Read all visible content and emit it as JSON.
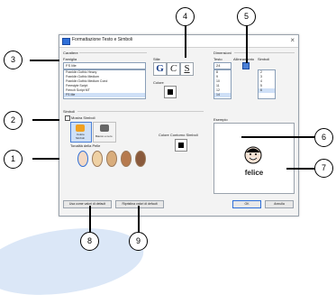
{
  "dialog": {
    "title": "Formattazione Testo e Simboli",
    "close": "×"
  },
  "carattere": {
    "section_label": "Carattere",
    "font_label": "Famiglia",
    "font_value": "FS Me",
    "font_list": [
      "Franklin Gothic Heavy",
      "Franklin Gothic Medium",
      "Franklin Gothic Medium Cond",
      "Freestyle Script",
      "French Script MT",
      "FS Me"
    ]
  },
  "stile": {
    "label": "Stile",
    "bold": "G",
    "italic": "C",
    "underline": "S",
    "color_label": "Colore"
  },
  "dimensioni": {
    "section_label": "Dimensioni",
    "testo_label": "Testo",
    "testo_value": "24",
    "testo_list": [
      "8",
      "9",
      "10",
      "11",
      "12",
      "14"
    ],
    "allineamento_label": "Allineamento",
    "simboli_label": "Simboli",
    "simboli_list": [
      "2",
      "3",
      "4",
      "5",
      "6"
    ]
  },
  "simboli": {
    "section_label": "Simboli",
    "mostra_label": "Mostra Simboli",
    "colore_label": "Colore",
    "colore_sub": "Simboli",
    "bianco_label": "Bianco e nero",
    "tonalita_label": "Tonalità della Pelle",
    "contorno_label": "Colore Contorno Simboli"
  },
  "esempio": {
    "label": "Esempio",
    "word": "felice"
  },
  "buttons": {
    "usa_come": "Usa come valori di default",
    "ripristina": "Ripristina valori di default",
    "ok": "OK",
    "annulla": "Annulla"
  },
  "callouts": [
    "1",
    "2",
    "3",
    "4",
    "5",
    "6",
    "7",
    "8",
    "9"
  ],
  "colors": {
    "accent": "#2f6fd8",
    "skin_tones": [
      "#f3d9c4",
      "#efd1a4",
      "#d9ad7c",
      "#b67a4e",
      "#8a5a3c"
    ]
  }
}
